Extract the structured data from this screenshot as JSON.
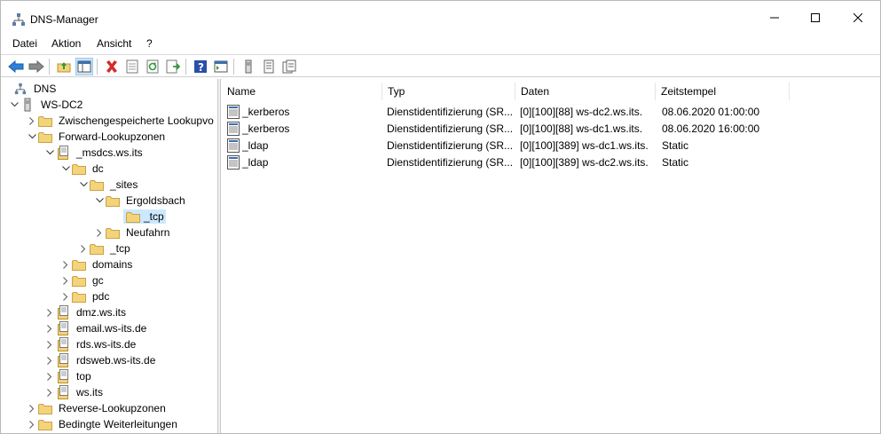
{
  "window": {
    "title": "DNS-Manager"
  },
  "menu": [
    "Datei",
    "Aktion",
    "Ansicht",
    "?"
  ],
  "toolbar_icons": [
    "back-arrow-icon",
    "forward-arrow-icon",
    "up-folder-icon",
    "show-hide-tree-icon",
    "delete-icon",
    "properties-icon",
    "refresh-icon",
    "export-list-icon",
    "help-icon",
    "console-pane-icon",
    "server-icon",
    "record-list-icon",
    "record-details-icon"
  ],
  "tree": {
    "root": "DNS",
    "server": "WS-DC2",
    "cached": "Zwischengespeicherte Lookupvo",
    "forward": "Forward-Lookupzonen",
    "msdcs": "_msdcs.ws.its",
    "dc": "dc",
    "sites": "_sites",
    "ergoldsbach": "Ergoldsbach",
    "tcp_sel": "_tcp",
    "neufahrn": "Neufahrn",
    "tcp": "_tcp",
    "domains": "domains",
    "gc": "gc",
    "pdc": "pdc",
    "dmz": "dmz.ws.its",
    "email": "email.ws-its.de",
    "rds": "rds.ws-its.de",
    "rdsweb": "rdsweb.ws-its.de",
    "top": "top",
    "wsits": "ws.its",
    "reverse": "Reverse-Lookupzonen",
    "conditional": "Bedingte Weiterleitungen"
  },
  "list": {
    "columns": [
      "Name",
      "Typ",
      "Daten",
      "Zeitstempel"
    ],
    "rows": [
      {
        "name": "_kerberos",
        "typ": "Dienstidentifizierung (SR...",
        "daten": "[0][100][88] ws-dc2.ws.its.",
        "zeit": "08.06.2020 01:00:00"
      },
      {
        "name": "_kerberos",
        "typ": "Dienstidentifizierung (SR...",
        "daten": "[0][100][88] ws-dc1.ws.its.",
        "zeit": "08.06.2020 16:00:00"
      },
      {
        "name": "_ldap",
        "typ": "Dienstidentifizierung (SR...",
        "daten": "[0][100][389] ws-dc1.ws.its.",
        "zeit": "Static"
      },
      {
        "name": "_ldap",
        "typ": "Dienstidentifizierung (SR...",
        "daten": "[0][100][389] ws-dc2.ws.its.",
        "zeit": "Static"
      }
    ]
  },
  "colors": {
    "selection": "#cce8ff",
    "folder": "#f3d37b"
  }
}
